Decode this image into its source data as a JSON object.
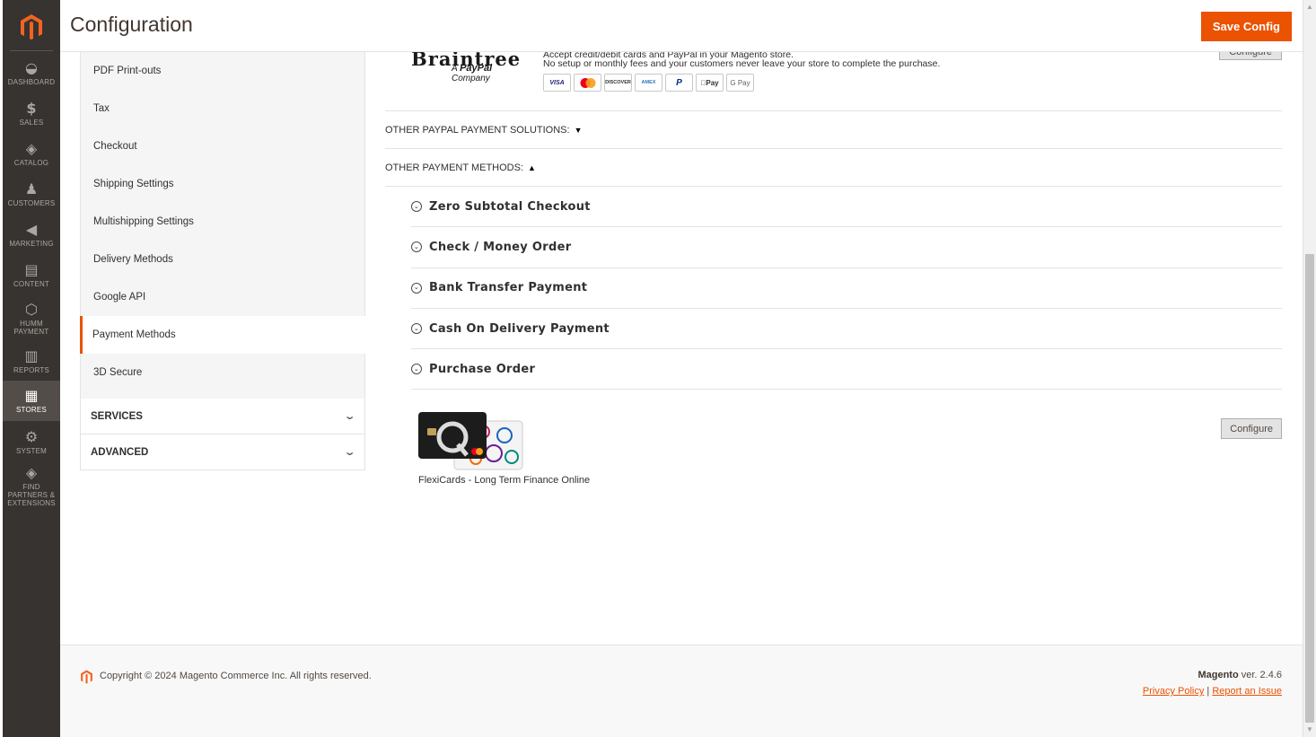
{
  "nav": {
    "items": [
      {
        "label": "DASHBOARD",
        "icon": "dashboard-icon",
        "glyph": "◒"
      },
      {
        "label": "SALES",
        "icon": "dollar-icon",
        "glyph": "$"
      },
      {
        "label": "CATALOG",
        "icon": "cube-icon",
        "glyph": "◈"
      },
      {
        "label": "CUSTOMERS",
        "icon": "person-icon",
        "glyph": "♟"
      },
      {
        "label": "MARKETING",
        "icon": "megaphone-icon",
        "glyph": "◀"
      },
      {
        "label": "CONTENT",
        "icon": "layout-icon",
        "glyph": "▤"
      },
      {
        "label": "HUMM PAYMENT",
        "icon": "hexagon-icon",
        "glyph": "⬡"
      },
      {
        "label": "REPORTS",
        "icon": "bar-chart-icon",
        "glyph": "▥"
      },
      {
        "label": "STORES",
        "icon": "store-icon",
        "glyph": "▦"
      },
      {
        "label": "SYSTEM",
        "icon": "gear-icon",
        "glyph": "⚙"
      },
      {
        "label": "FIND PARTNERS & EXTENSIONS",
        "icon": "box-icon",
        "glyph": "◈"
      }
    ]
  },
  "header": {
    "title": "Configuration",
    "save_label": "Save Config"
  },
  "tabs": {
    "items": [
      {
        "label": "PDF Print-outs"
      },
      {
        "label": "Tax"
      },
      {
        "label": "Checkout"
      },
      {
        "label": "Shipping Settings"
      },
      {
        "label": "Multishipping Settings"
      },
      {
        "label": "Delivery Methods"
      },
      {
        "label": "Google API"
      },
      {
        "label": "Payment Methods"
      },
      {
        "label": "3D Secure"
      }
    ],
    "sections": [
      {
        "label": "SERVICES"
      },
      {
        "label": "ADVANCED"
      }
    ]
  },
  "braintree": {
    "logo_word": "Braintree",
    "logo_sub_prefix": "A ",
    "logo_sub_brand": "PayPal",
    "logo_sub_suffix": " Company",
    "text1": "Accept credit/debit cards and PayPal in your Magento store.",
    "text2": "No setup or monthly fees and your customers never leave your store to complete the purchase.",
    "cards": [
      "VISA",
      "MC",
      "DISCOVER",
      "AMEX",
      "P",
      "Pay",
      "G Pay"
    ],
    "configure_label": "Configure"
  },
  "groups": {
    "other_paypal": "OTHER PAYPAL PAYMENT SOLUTIONS:",
    "other_methods": "OTHER PAYMENT METHODS:"
  },
  "methods": [
    {
      "label": "Zero Subtotal Checkout"
    },
    {
      "label": "Check / Money Order"
    },
    {
      "label": "Bank Transfer Payment"
    },
    {
      "label": "Cash On Delivery Payment"
    },
    {
      "label": "Purchase Order"
    }
  ],
  "flexi": {
    "caption": "FlexiCards - Long Term Finance Online",
    "configure_label": "Configure"
  },
  "footer": {
    "copyright": "Copyright © 2024 Magento Commerce Inc. All rights reserved.",
    "brand": "Magento",
    "version": " ver. 2.4.6",
    "privacy": "Privacy Policy",
    "separator": " | ",
    "report": "Report an Issue"
  },
  "colors": {
    "accent": "#eb5202",
    "nav_bg": "#373330"
  }
}
